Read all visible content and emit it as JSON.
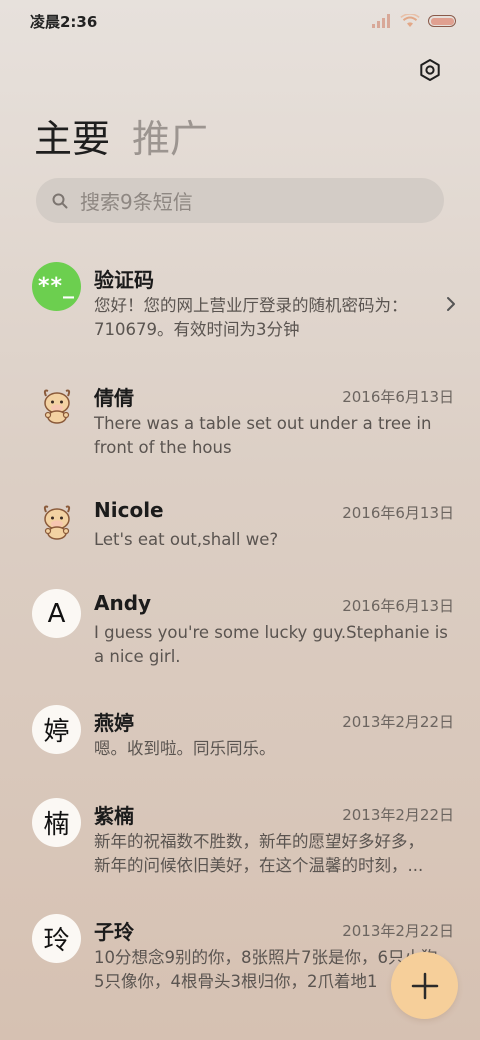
{
  "status_bar": {
    "time": "凌晨2:36",
    "icons": [
      "signal-icon",
      "wifi-icon",
      "battery-icon"
    ],
    "battery_color": "#e0a090"
  },
  "header": {
    "settings_icon": "settings-icon",
    "tabs": [
      {
        "label": "主要",
        "active": true
      },
      {
        "label": "推广",
        "active": false
      }
    ]
  },
  "search": {
    "placeholder": "搜索9条短信",
    "icon": "search-icon"
  },
  "conversations": [
    {
      "name": "验证码",
      "avatar_type": "text",
      "avatar_text": "**_",
      "avatar_color": "#6ccf4f",
      "date": "",
      "preview_line1": "您好！您的网上营业厅登录的随机密码为：",
      "preview_line2": "710679。有效时间为3分钟",
      "has_chevron": true
    },
    {
      "name": "倩倩",
      "avatar_type": "sticker",
      "avatar_text": "",
      "date": "2016年6月13日",
      "preview_line1": "There was a table set out under a tree in",
      "preview_line2": "front of the hous"
    },
    {
      "name": "Nicole",
      "avatar_type": "sticker",
      "avatar_text": "",
      "date": "2016年6月13日",
      "preview_line1": "Let's eat out,shall we?",
      "preview_line2": ""
    },
    {
      "name": "Andy",
      "avatar_type": "letter",
      "avatar_text": "A",
      "date": "2016年6月13日",
      "preview_line1": "I guess you're some lucky guy.Stephanie is",
      "preview_line2": "a nice girl."
    },
    {
      "name": "燕婷",
      "avatar_type": "letter",
      "avatar_text": "婷",
      "date": "2013年2月22日",
      "preview_line1": "嗯。收到啦。同乐同乐。",
      "preview_line2": ""
    },
    {
      "name": "紫楠",
      "avatar_type": "letter",
      "avatar_text": "楠",
      "date": "2013年2月22日",
      "preview_line1": "新年的祝福数不胜数，新年的愿望好多好多，",
      "preview_line2": "新年的问候依旧美好，在这个温馨的时刻，..."
    },
    {
      "name": "子玲",
      "avatar_type": "letter",
      "avatar_text": "玲",
      "date": "2013年2月22日",
      "preview_line1": "10分想念9别的你，8张照片7张是你，6只小狗",
      "preview_line2": "5只像你，4根骨头3根归你，2爪着地1"
    }
  ],
  "fab": {
    "icon": "plus-icon",
    "color": "#f6cf9a"
  }
}
